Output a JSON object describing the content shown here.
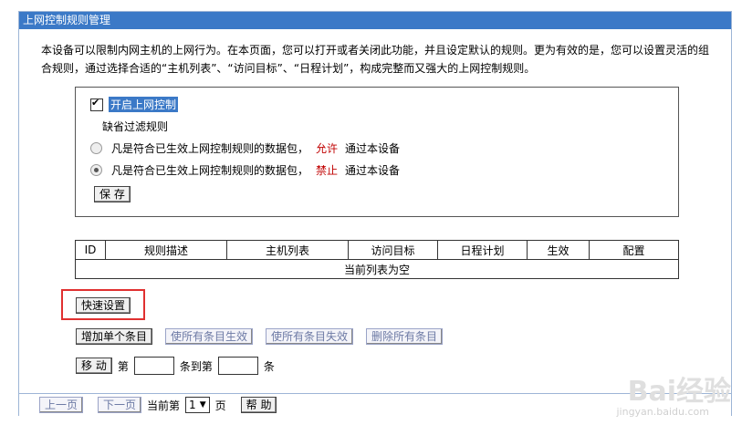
{
  "panel": {
    "title": "上网控制规则管理",
    "description": "本设备可以限制内网主机的上网行为。在本页面，您可以打开或者关闭此功能，并且设定默认的规则。更为有效的是，您可以设置灵活的组合规则，通过选择合适的“主机列表”、“访问目标”、“日程计划”，构成完整而又强大的上网控制规则。"
  },
  "control": {
    "enable_label": "开启上网控制",
    "default_rule_label": "缺省过滤规则",
    "allow_prefix": "凡是符合已生效上网控制规则的数据包，",
    "allow_word": "允许",
    "allow_suffix": "通过本设备",
    "deny_prefix": "凡是符合已生效上网控制规则的数据包，",
    "deny_word": "禁止",
    "deny_suffix": "通过本设备",
    "save_label": "保 存"
  },
  "table": {
    "headers": [
      "ID",
      "规则描述",
      "主机列表",
      "访问目标",
      "日程计划",
      "生效",
      "配置"
    ],
    "empty_message": "当前列表为空"
  },
  "actions": {
    "quick_setup": "快速设置",
    "add_single": "增加单个条目",
    "enable_all": "使所有条目生效",
    "disable_all": "使所有条目失效",
    "delete_all": "删除所有条目",
    "move": "移 动",
    "move_from_prefix": "第",
    "move_to_label": "条到第",
    "move_suffix": "条"
  },
  "footer": {
    "prev": "上一页",
    "next": "下一页",
    "current_page_label": "当前第",
    "page_value": "1",
    "page_suffix": "页",
    "help": "帮 助"
  },
  "watermark": {
    "brand": "Bai经验",
    "url": "jingyan.baidu.com"
  }
}
